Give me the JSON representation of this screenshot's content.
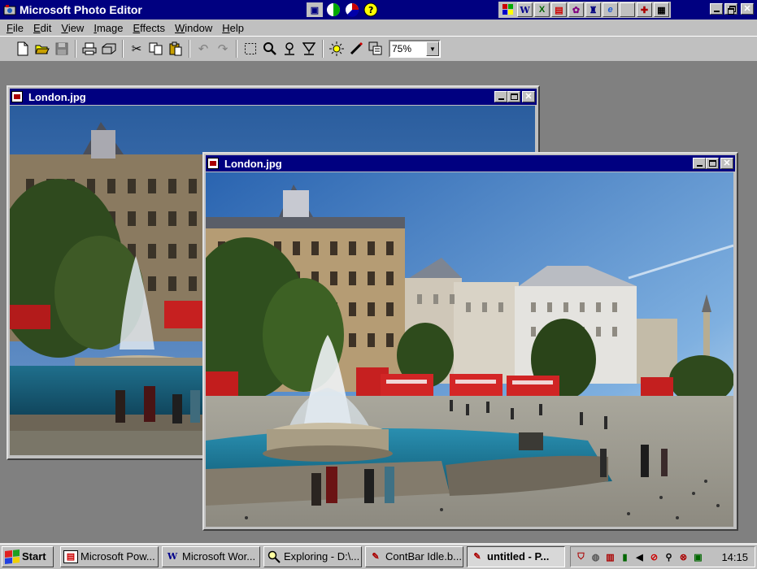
{
  "app": {
    "title": "Microsoft Photo Editor"
  },
  "menu": [
    "File",
    "Edit",
    "View",
    "Image",
    "Effects",
    "Window",
    "Help"
  ],
  "toolbar": {
    "zoom_value": "75%"
  },
  "windows": [
    {
      "title": "London.jpg"
    },
    {
      "title": "London.jpg"
    }
  ],
  "taskbar": {
    "start_label": "Start",
    "tasks": [
      "Microsoft Pow...",
      "Microsoft Wor...",
      "Exploring - D:\\...",
      "ContBar Idle.b...",
      "untitled - P..."
    ],
    "clock": "14:15"
  },
  "colors": {
    "titlebar_active": "#000080",
    "face": "#c0c0c0",
    "desktop": "#808080"
  }
}
